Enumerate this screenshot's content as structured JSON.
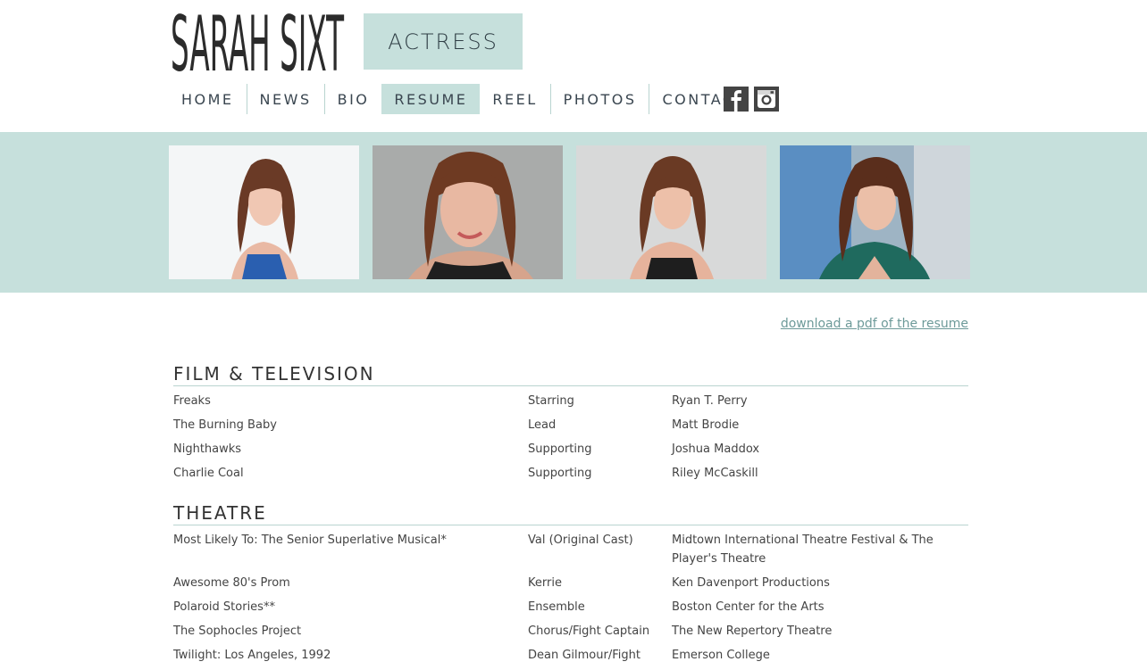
{
  "site": {
    "logo_text": "SARAH SIXT",
    "role": "ACTRESS"
  },
  "nav": {
    "items": [
      {
        "label": "HOME"
      },
      {
        "label": "NEWS"
      },
      {
        "label": "BIO"
      },
      {
        "label": "RESUME",
        "active": true
      },
      {
        "label": "REEL"
      },
      {
        "label": "PHOTOS"
      },
      {
        "label": "CONTACT"
      }
    ],
    "social": [
      "facebook-icon",
      "instagram-icon"
    ]
  },
  "colors": {
    "accent": "#c6e0dc",
    "link": "#6d9a99",
    "text": "#333333"
  },
  "resume": {
    "pdf_link": "download a pdf of the resume",
    "sections": [
      {
        "title": "FILM & TELEVISION",
        "rows": [
          [
            "Freaks",
            "Starring",
            "Ryan T. Perry"
          ],
          [
            "The Burning Baby",
            "Lead",
            "Matt Brodie"
          ],
          [
            "Nighthawks",
            "Supporting",
            "Joshua Maddox"
          ],
          [
            "Charlie Coal",
            "Supporting",
            "Riley McCaskill"
          ]
        ]
      },
      {
        "title": "THEATRE",
        "rows": [
          [
            "Most Likely To: The Senior Superlative Musical*",
            "Val (Original Cast)",
            "Midtown International Theatre Festival & The Player's Theatre"
          ],
          [
            "Awesome 80's Prom",
            "Kerrie",
            "Ken Davenport Productions"
          ],
          [
            "Polaroid Stories**",
            "Ensemble",
            "Boston Center for the Arts"
          ],
          [
            "The Sophocles Project",
            "Chorus/Fight Captain",
            "The New Repertory Theatre"
          ],
          [
            "Twilight: Los Angeles, 1992",
            "Dean Gilmour/Fight",
            "Emerson College"
          ]
        ]
      }
    ]
  }
}
